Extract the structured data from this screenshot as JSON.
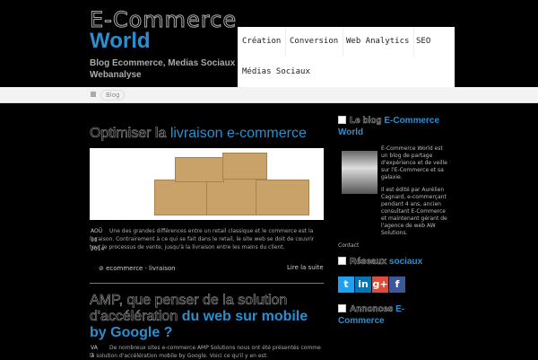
{
  "site": {
    "logo_line1": "E-Commerce",
    "logo_line2": "World",
    "tagline": "Blog Ecommerce, Medias Sociaux & Webanalyse"
  },
  "nav": [
    "Création",
    "Conversion",
    "Web Analytics",
    "SEO",
    "Médias Sociaux"
  ],
  "breadcrumb": {
    "current": "Blog"
  },
  "posts": [
    {
      "title_a": "Optimiser la",
      "title_b": "livraison e-commerce",
      "date": [
        "AOÛ",
        "11",
        "2014"
      ],
      "excerpt": "Une des grandes différences entre un retail classique et le commerce est la livraison. Contrairement à ce qui se fait dans le retail, le site web se doit de couvrir tout le processus de vente, jusqu'à la livraison entre les mains du client.",
      "tags": [
        "ecommerce",
        "livraison"
      ],
      "more": "Lire la suite"
    },
    {
      "title_a": "AMP, que penser de la solution d'accélération",
      "title_b": "du web sur mobile by Google ?",
      "date": [
        "VA",
        "7"
      ],
      "excerpt": "De nombreux sites e-commerce AMP Solutions nous ont été présentés comme la solution d'accélération mobile by Google. Voici ce qu'il y en est."
    }
  ],
  "sidebar": {
    "blog_title_a": "Le blog",
    "blog_title_b": "E-Commerce World",
    "bio1": "E-Commerce World est un blog de partage d'expérience et de veille sur l'E-Commerce et sa galaxie.",
    "bio2": "Il est édité par Aurélien Cagnard, e-commerçant pendant 4 ans, ancien consultant E-Commerce et maintenant gérant de l'agence de web AW Solutions.",
    "contact": "Contact",
    "social_a": "Réseaux",
    "social_b": "sociaux",
    "social": [
      "t",
      "in",
      "g+",
      "f"
    ],
    "ads_a": "Annonces",
    "ads_b": "E-Commerce"
  }
}
